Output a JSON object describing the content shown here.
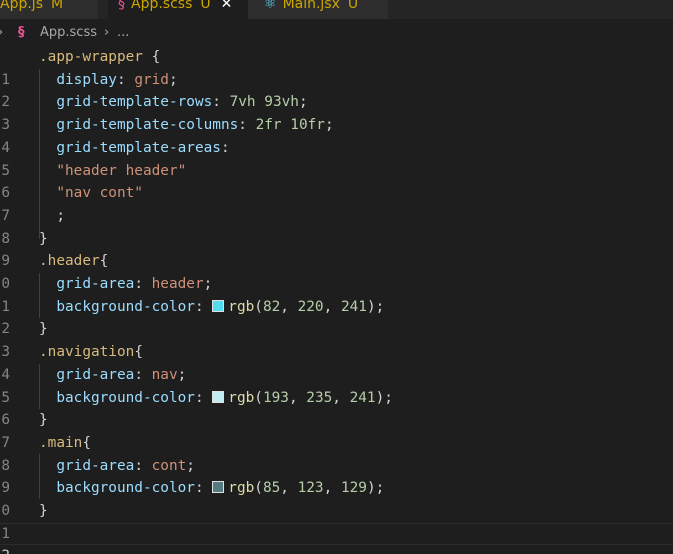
{
  "tabs": [
    {
      "label": "App.js",
      "status": "M"
    },
    {
      "label": "App.scss",
      "status": "U"
    },
    {
      "label": "Main.jsx",
      "status": "U"
    }
  ],
  "breadcrumb": {
    "file": "App.scss",
    "more": "..."
  },
  "colors": {
    "swatch_header": "#52dcf1",
    "swatch_nav": "#c1ebf1",
    "swatch_main": "#557b81"
  },
  "line_numbers": [
    "1",
    "2",
    "3",
    "4",
    "5",
    "6",
    "7",
    "8",
    "9",
    "0",
    "1",
    "2",
    "3",
    "4",
    "5",
    "6",
    "7",
    "8",
    "9",
    "0",
    "1",
    "2"
  ],
  "code": {
    "l1": {
      "selector": ".app-wrapper",
      "brace": "{"
    },
    "l2": {
      "prop": "display",
      "value": "grid"
    },
    "l3": {
      "prop": "grid-template-rows",
      "v1": "7vh",
      "v2": "93vh"
    },
    "l4": {
      "prop": "grid-template-columns",
      "v1": "2fr",
      "v2": "10fr"
    },
    "l5": {
      "prop": "grid-template-areas"
    },
    "l6": {
      "str": "\"header header\""
    },
    "l7": {
      "str": "\"nav cont\""
    },
    "l8": {
      "semi": ";"
    },
    "l9": {
      "brace": "}"
    },
    "l10": {
      "selector": ".header",
      "brace": "{"
    },
    "l11": {
      "prop": "grid-area",
      "value": "header"
    },
    "l12": {
      "prop": "background-color",
      "fn": "rgb",
      "r": "82",
      "g": "220",
      "b": "241"
    },
    "l13": {
      "brace": "}"
    },
    "l14": {
      "selector": ".navigation",
      "brace": "{"
    },
    "l15": {
      "prop": "grid-area",
      "value": "nav"
    },
    "l16": {
      "prop": "background-color",
      "fn": "rgb",
      "r": "193",
      "g": "235",
      "b": "241"
    },
    "l17": {
      "brace": "}"
    },
    "l18": {
      "selector": ".main",
      "brace": "{"
    },
    "l19": {
      "prop": "grid-area",
      "value": "cont"
    },
    "l20": {
      "prop": "background-color",
      "fn": "rgb",
      "r": "85",
      "g": "123",
      "b": "129"
    },
    "l21": {
      "brace": "}"
    }
  }
}
